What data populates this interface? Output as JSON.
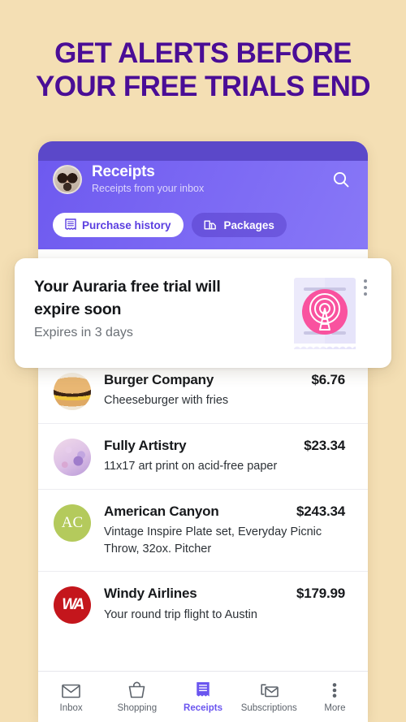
{
  "headline": {
    "line1": "GET ALERTS BEFORE",
    "line2": "YOUR FREE TRIALS END",
    "color": "#4a0d96"
  },
  "background_color": "#f4dfb4",
  "app": {
    "header": {
      "title": "Receipts",
      "subtitle": "Receipts from your inbox",
      "avatar_name": "user-avatar",
      "search_icon": "search-icon",
      "gradient_from": "#6d59ef",
      "gradient_to": "#8878f7",
      "tabs": [
        {
          "label": "Purchase history",
          "icon": "receipt-icon",
          "active": true
        },
        {
          "label": "Packages",
          "icon": "package-truck-icon",
          "active": false
        }
      ]
    },
    "notification": {
      "title": "Your Auraria free trial will expire soon",
      "subtitle": "Expires in 3 days",
      "thumbnail_icon": "broadcast-tower-receipt-icon",
      "thumbnail_accent": "#f9529f",
      "menu_icon": "more-vertical-icon"
    },
    "receipts": [
      {
        "merchant": "Burger Company",
        "description": "Cheeseburger with fries",
        "amount": "$6.76",
        "thumb": "burger-photo"
      },
      {
        "merchant": "Fully Artistry",
        "description": "11x17 art print on acid-free paper",
        "amount": "$23.34",
        "thumb": "art-print-photo"
      },
      {
        "merchant": "American Canyon",
        "description": "Vintage Inspire Plate set, Everyday Picnic Throw, 32ox. Pitcher",
        "amount": "$243.34",
        "thumb": "AC",
        "thumb_color": "#b4ca5c"
      },
      {
        "merchant": "Windy Airlines",
        "description": "Your round trip flight to Austin",
        "amount": "$179.99",
        "thumb": "WA",
        "thumb_color": "#c4161c"
      }
    ],
    "bottom_nav": {
      "active_color": "#6a55ef",
      "items": [
        {
          "label": "Inbox",
          "icon": "envelope-icon",
          "active": false
        },
        {
          "label": "Shopping",
          "icon": "shopping-bag-icon",
          "active": false
        },
        {
          "label": "Receipts",
          "icon": "receipt-icon",
          "active": true
        },
        {
          "label": "Subscriptions",
          "icon": "envelope-refresh-icon",
          "active": false
        },
        {
          "label": "More",
          "icon": "more-vertical-icon",
          "active": false
        }
      ]
    }
  }
}
